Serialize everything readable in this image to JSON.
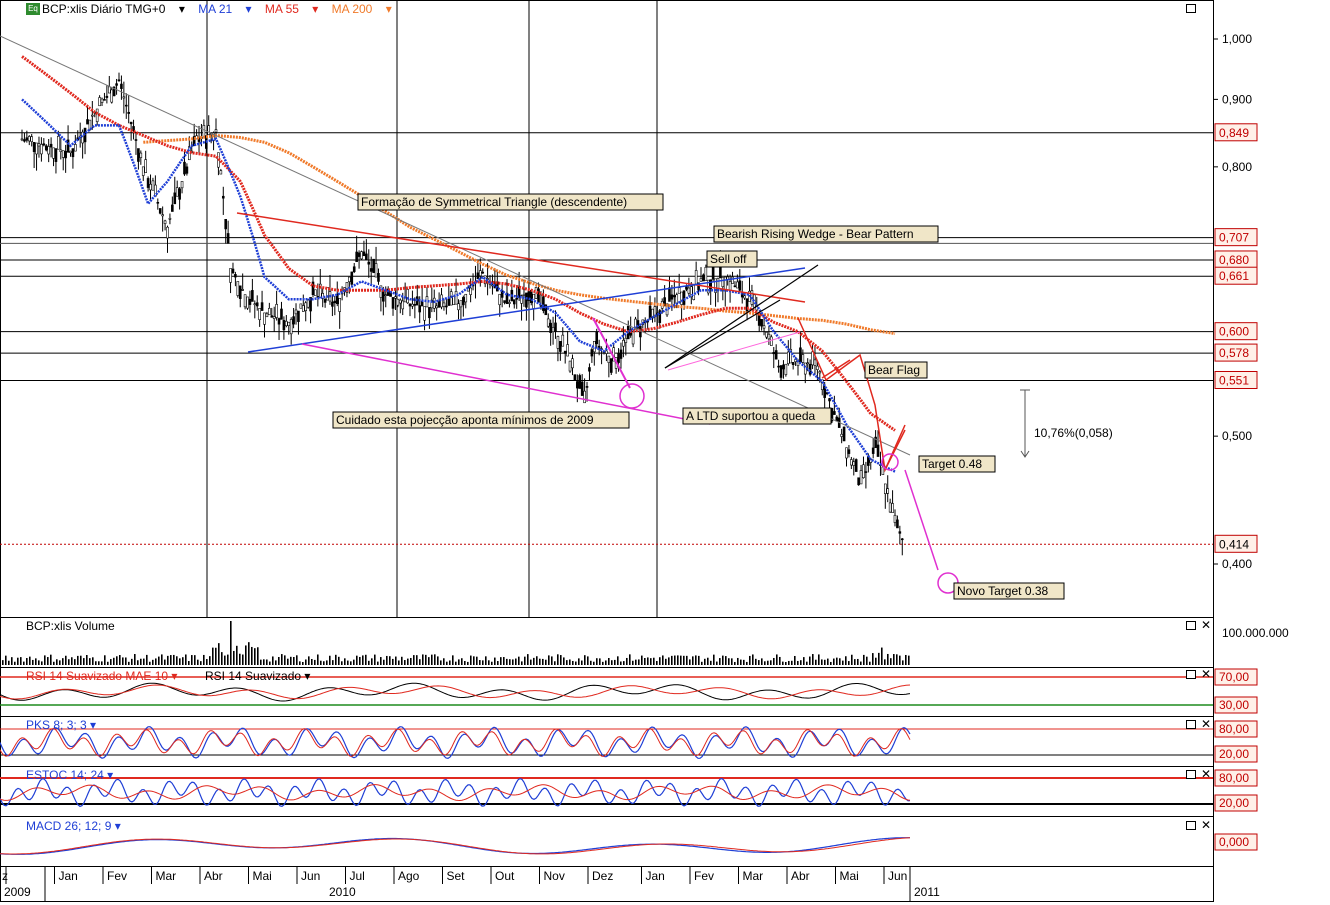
{
  "header": {
    "symbol": "BCP:xlis Diário TMG+0",
    "ma1": "MA 21",
    "ma2": "MA 55",
    "ma3": "MA 200",
    "colors": {
      "ma21": "#1f3fd6",
      "ma55": "#e0291f",
      "ma200": "#f07a2a",
      "price": "#000000"
    }
  },
  "chart_data": {
    "type": "line",
    "title": "BCP:xlis Diário TMG+0",
    "log_scale": true,
    "y_ticks": [
      "1,000",
      "0,900",
      "0,800",
      "0,500",
      "0,400"
    ],
    "y_tick_values": [
      1.0,
      0.9,
      0.8,
      0.5,
      0.4
    ],
    "price_tags": [
      {
        "label": "0,849",
        "value": 0.849
      },
      {
        "label": "0,707",
        "value": 0.707
      },
      {
        "label": "0,680",
        "value": 0.68
      },
      {
        "label": "0,661",
        "value": 0.661
      },
      {
        "label": "0,600",
        "value": 0.6
      },
      {
        "label": "0,578",
        "value": 0.578
      },
      {
        "label": "0,551",
        "value": 0.551
      },
      {
        "label": "0,414",
        "value": 0.414
      }
    ],
    "x_months": [
      "z",
      "Jan",
      "Fev",
      "Mar",
      "Abr",
      "Mai",
      "Jun",
      "Jul",
      "Ago",
      "Set",
      "Out",
      "Nov",
      "Dez",
      "Jan",
      "Fev",
      "Mar",
      "Abr",
      "Mai",
      "Jun"
    ],
    "x_years": [
      "2009",
      "2010",
      "2011"
    ],
    "series": [
      {
        "name": "BCP:xlis",
        "x": [
          0,
          1,
          1.5,
          2,
          2.5,
          3,
          3.3,
          3.6,
          4,
          4.3,
          4.6,
          5,
          5.5,
          6,
          6.5,
          7,
          7.5,
          8,
          8.5,
          9,
          9.5,
          10,
          10.5,
          11,
          11.3,
          11.6,
          11.8,
          12.2,
          12.6,
          13,
          13.5,
          14,
          14.5,
          14.8,
          15.2,
          15.6,
          16,
          16.4,
          16.7,
          17,
          17.3,
          17.6,
          17.8,
          18,
          18.2
        ],
        "values": [
          0.84,
          0.82,
          0.88,
          0.93,
          0.8,
          0.72,
          0.78,
          0.84,
          0.85,
          0.67,
          0.64,
          0.62,
          0.61,
          0.64,
          0.63,
          0.69,
          0.64,
          0.63,
          0.625,
          0.63,
          0.665,
          0.63,
          0.645,
          0.6,
          0.57,
          0.53,
          0.59,
          0.57,
          0.6,
          0.615,
          0.64,
          0.655,
          0.66,
          0.645,
          0.62,
          0.565,
          0.57,
          0.565,
          0.525,
          0.49,
          0.46,
          0.49,
          0.46,
          0.43,
          0.414
        ]
      },
      {
        "name": "MA 21",
        "x": [
          0,
          1,
          1.5,
          2,
          2.6,
          3,
          3.5,
          4,
          4.5,
          5,
          5.5,
          6,
          6.5,
          7,
          7.5,
          8,
          8.5,
          9,
          9.5,
          10,
          10.5,
          11,
          11.5,
          12,
          12.5,
          13,
          13.5,
          14,
          14.5,
          15,
          15.5,
          16,
          16.5,
          17,
          17.5,
          18
        ],
        "values": [
          0.9,
          0.83,
          0.86,
          0.86,
          0.75,
          0.78,
          0.83,
          0.84,
          0.76,
          0.66,
          0.635,
          0.635,
          0.64,
          0.655,
          0.645,
          0.635,
          0.632,
          0.64,
          0.66,
          0.64,
          0.635,
          0.62,
          0.59,
          0.58,
          0.6,
          0.615,
          0.63,
          0.645,
          0.645,
          0.64,
          0.6,
          0.57,
          0.55,
          0.51,
          0.48,
          0.47
        ]
      },
      {
        "name": "MA 55",
        "x": [
          0,
          1,
          1.5,
          2,
          2.5,
          3,
          3.5,
          4,
          4.5,
          5,
          5.5,
          6,
          6.5,
          7,
          7.5,
          8,
          8.5,
          9,
          9.5,
          10,
          10.5,
          11,
          11.5,
          12,
          12.5,
          13,
          13.5,
          14,
          14.5,
          15,
          15.5,
          16,
          16.5,
          17,
          17.5,
          18
        ],
        "values": [
          0.97,
          0.91,
          0.88,
          0.86,
          0.845,
          0.83,
          0.82,
          0.815,
          0.78,
          0.71,
          0.67,
          0.65,
          0.645,
          0.645,
          0.645,
          0.648,
          0.65,
          0.652,
          0.655,
          0.652,
          0.645,
          0.635,
          0.62,
          0.608,
          0.6,
          0.603,
          0.61,
          0.618,
          0.625,
          0.625,
          0.61,
          0.6,
          0.58,
          0.55,
          0.52,
          0.505
        ]
      },
      {
        "name": "MA 200",
        "x": [
          2.5,
          3.5,
          4,
          4.5,
          5,
          5.5,
          6,
          6.5,
          7,
          7.5,
          8,
          8.5,
          9,
          9.5,
          10,
          10.5,
          11,
          11.5,
          12,
          12.5,
          13,
          13.5,
          14,
          14.5,
          15,
          15.5,
          16,
          16.5,
          17,
          17.5,
          18
        ],
        "values": [
          0.835,
          0.84,
          0.845,
          0.842,
          0.835,
          0.82,
          0.8,
          0.78,
          0.76,
          0.74,
          0.72,
          0.705,
          0.69,
          0.675,
          0.662,
          0.653,
          0.645,
          0.64,
          0.636,
          0.633,
          0.63,
          0.627,
          0.625,
          0.622,
          0.62,
          0.617,
          0.614,
          0.612,
          0.608,
          0.602,
          0.598
        ]
      }
    ],
    "annotations": [
      "Formação de Symmetrical Triangle (descendente)",
      "Bearish Rising Wedge - Bear Pattern",
      "Sell off",
      "Bear Flag",
      "Target  0.48",
      "10,76%(0,058)",
      "A LTD suportou a queda",
      "Cuidado esta pojecção aponta mínimos de 2009",
      "Novo Target  0.38"
    ]
  },
  "volume_panel": {
    "title": "BCP:xlis Volume",
    "tick": "100.000.000"
  },
  "rsi_panel": {
    "title1": "RSI 14 Suavizado MAE 10",
    "title2": "RSI 14 Suavizado",
    "ticks": [
      "70,00",
      "30,00"
    ]
  },
  "pks_panel": {
    "title": "PKS 8; 3; 3",
    "ticks": [
      "80,00",
      "20,00"
    ]
  },
  "estoc_panel": {
    "title": "ESTOC 14; 24",
    "ticks": [
      "80,00",
      "20,00"
    ]
  },
  "macd_panel": {
    "title": "MACD 26; 12; 9",
    "tick": "0,000"
  }
}
